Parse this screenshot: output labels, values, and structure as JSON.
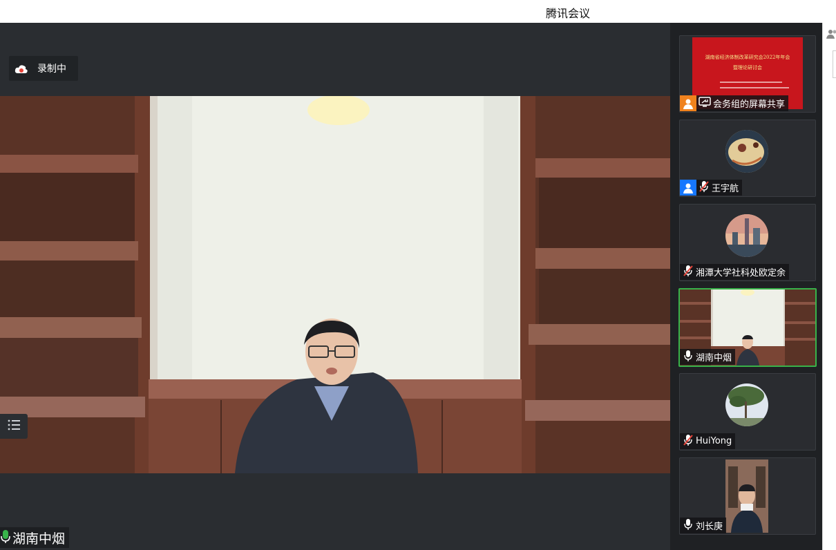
{
  "window": {
    "title": "腾讯会议"
  },
  "recording": {
    "label": "录制中"
  },
  "main_speaker": {
    "name": "湖南中烟"
  },
  "participants": [
    {
      "label": "会务组的屏幕共享",
      "banner_line1": "湖南省经济体制改革研究会2022年年会",
      "banner_line2": "暨理论研讨会"
    },
    {
      "label": "王宇航"
    },
    {
      "label": "湘潭大学社科处欧定余"
    },
    {
      "label": "湖南中烟"
    },
    {
      "label": "HuiYong"
    },
    {
      "label": "刘长庚"
    }
  ],
  "colors": {
    "active_speaker_border": "#38b34a",
    "share_badge": "#f0821e",
    "user_badge": "#1677ff",
    "banner_red": "#c8161d"
  }
}
